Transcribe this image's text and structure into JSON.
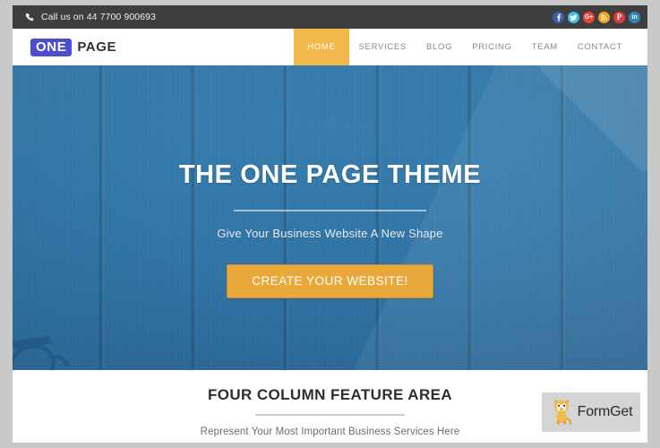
{
  "colors": {
    "topbar_bg": "#3e3e3e",
    "accent_amber": "#f2b84b",
    "cta_amber": "#e8a93a",
    "logo_purple": "#4d4dcf",
    "hero_blue": "#3379ab",
    "frame_grey": "#c9c9c9"
  },
  "topbar": {
    "phone_icon": "phone-icon",
    "contact_text": "Call us on 44 7700 900693",
    "socials": [
      {
        "name": "facebook",
        "glyph": "f",
        "color": "#3b5fa8"
      },
      {
        "name": "twitter",
        "glyph": "t",
        "color": "#3bbdf0"
      },
      {
        "name": "google-plus",
        "glyph": "G+",
        "color": "#ea4335"
      },
      {
        "name": "rss",
        "glyph": "r",
        "color": "#f2a21c"
      },
      {
        "name": "pinterest",
        "glyph": "P",
        "color": "#e03a3e"
      },
      {
        "name": "linkedin",
        "glyph": "in",
        "color": "#2a87bb"
      }
    ]
  },
  "header": {
    "logo": {
      "badge_text": "ONE",
      "word_text": "PAGE"
    },
    "nav": [
      {
        "label": "HOME",
        "active": true
      },
      {
        "label": "SERVICES",
        "active": false
      },
      {
        "label": "BLOG",
        "active": false
      },
      {
        "label": "PRICING",
        "active": false
      },
      {
        "label": "TEAM",
        "active": false
      },
      {
        "label": "CONTACT",
        "active": false
      }
    ]
  },
  "hero": {
    "title": "THE ONE PAGE THEME",
    "subtitle": "Give Your Business Website A New Shape",
    "cta_label": "CREATE YOUR WEBSITE!",
    "background_description": "blue painted wooden planks with eyeglasses"
  },
  "feature": {
    "title": "FOUR COLUMN FEATURE AREA",
    "subtitle": "Represent Your Most Important Business Services Here"
  },
  "watermark": {
    "brand": "FormGet",
    "mascot_icon": "cat-mascot-icon"
  }
}
